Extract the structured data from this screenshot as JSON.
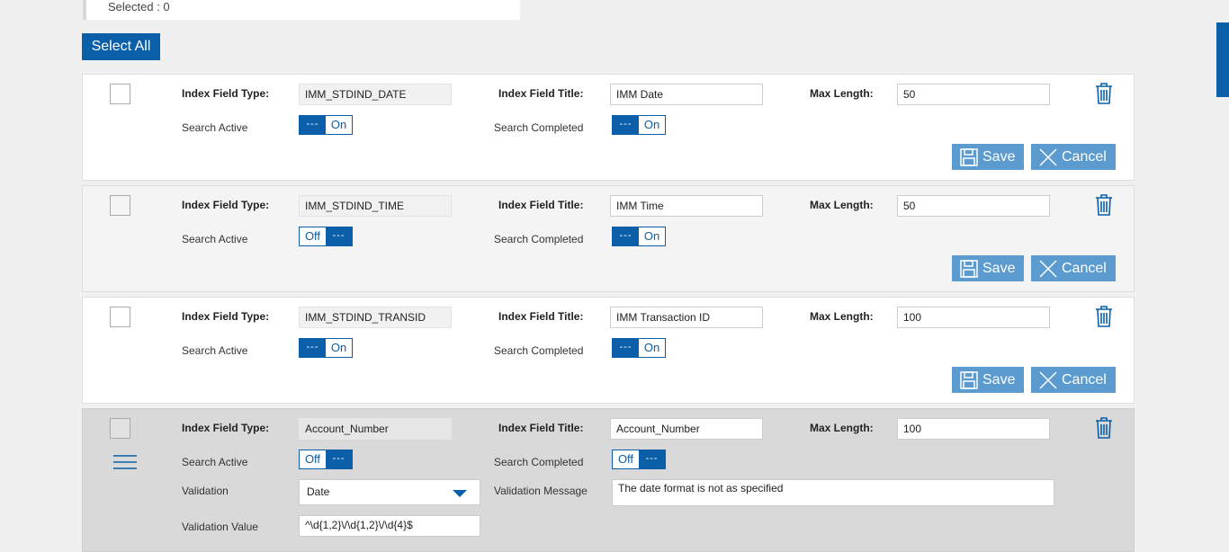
{
  "selected_text": "Selected : 0",
  "select_all_label": "Select All",
  "labels": {
    "index_field_type": "Index Field Type:",
    "index_field_title": "Index Field Title:",
    "max_length": "Max Length:",
    "search_active": "Search Active",
    "search_completed": "Search Completed",
    "validation": "Validation",
    "validation_message": "Validation Message",
    "validation_value": "Validation Value",
    "save": "Save",
    "cancel": "Cancel",
    "toggle_dots": "---"
  },
  "fields": [
    {
      "type": "IMM_STDIND_DATE",
      "title": "IMM Date",
      "max_length": "50",
      "search_active": "On",
      "search_completed": "On"
    },
    {
      "type": "IMM_STDIND_TIME",
      "title": "IMM Time",
      "max_length": "50",
      "search_active": "Off",
      "search_completed": "On"
    },
    {
      "type": "IMM_STDIND_TRANSID",
      "title": "IMM Transaction ID",
      "max_length": "100",
      "search_active": "On",
      "search_completed": "On"
    },
    {
      "type": "Account_Number",
      "title": "Account_Number",
      "max_length": "100",
      "search_active": "Off",
      "search_completed": "Off",
      "validation": "Date",
      "validation_message": "The date format is not as specified",
      "validation_value": "^\\d{1,2}\\/\\d{1,2}\\/\\d{4}$"
    }
  ],
  "colors": {
    "accent": "#0b5fa8",
    "button": "#5b9bd0"
  }
}
